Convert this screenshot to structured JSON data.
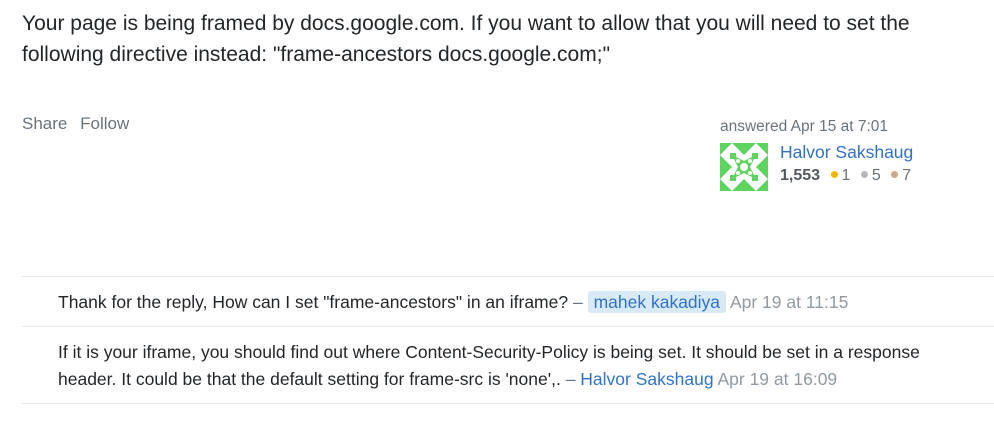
{
  "answer": {
    "body": "Your page is being framed by docs.google.com. If you want to allow that you will need to set the following directive instead: \"frame-ancestors docs.google.com;\""
  },
  "post_menu": {
    "share_label": "Share",
    "follow_label": "Follow"
  },
  "user_card": {
    "action_time": "answered Apr 15 at 7:01",
    "user_name": "Halvor Sakshaug",
    "reputation": "1,553",
    "gold_badges": "1",
    "silver_badges": "5",
    "bronze_badges": "7",
    "avatar_icon": "identicon-avatar",
    "avatar_color": "#5fd35f"
  },
  "badge_colors": {
    "gold": "#f1b600",
    "silver": "#b4b8bc",
    "bronze": "#d1a684"
  },
  "comments": [
    {
      "text": "Thank for the reply, How can I set \"frame-ancestors\" in an iframe?",
      "separator": "–",
      "user": "mahek kakadiya",
      "date": "Apr 19 at 11:15"
    },
    {
      "text": "If it is your iframe, you should find out where Content-Security-Policy is being set. It should be set in a response header. It could be that the default setting for frame-src is 'none',.",
      "separator": "–",
      "user": "Halvor Sakshaug",
      "date": "Apr 19 at 16:09"
    }
  ]
}
